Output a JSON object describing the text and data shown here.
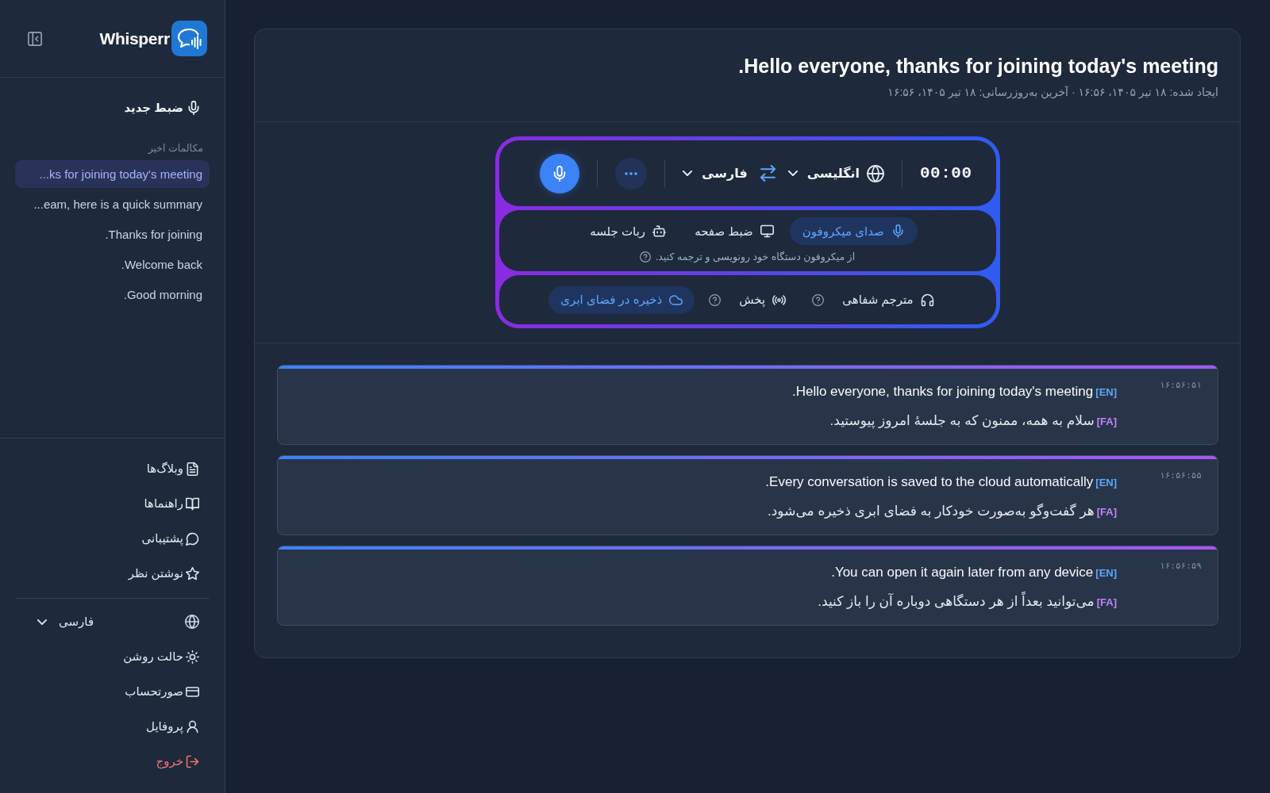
{
  "sidebar": {
    "brand": "Whisperr",
    "new_recording": "ضبط جدید",
    "recent_heading": "مکالمات اخیر",
    "conversations": [
      {
        "title": "...ks for joining today's meeting",
        "selected": true
      },
      {
        "title": "...eam, here is a quick summary",
        "selected": false
      },
      {
        "title": ".Thanks for joining",
        "selected": false
      },
      {
        "title": ".Welcome back",
        "selected": false
      },
      {
        "title": ".Good morning",
        "selected": false
      }
    ],
    "links": [
      {
        "label": "وبلاگ‌ها"
      },
      {
        "label": "راهنماها"
      },
      {
        "label": "پشتیبانی"
      },
      {
        "label": "نوشتن نظر"
      }
    ],
    "language": "فارسی",
    "account": [
      {
        "label": "حالت روشن",
        "kind": "link"
      },
      {
        "label": "صورتحساب",
        "kind": "link"
      },
      {
        "label": "پروفایل",
        "kind": "link"
      },
      {
        "label": "خروج",
        "kind": "danger"
      }
    ]
  },
  "meeting": {
    "title": ".Hello everyone, thanks for joining today's meeting",
    "meta": "ایجاد شده: ۱۸ تیر ۱۴۰۵، ۱۶:۵۶ · آخرین به‌روزرسانی: ۱۸ تیر ۱۴۰۵، ۱۶:۵۶"
  },
  "recorder": {
    "timer": "00:00",
    "source_language": "انگلیسی",
    "target_language": "فارسی",
    "sources": [
      {
        "label": "صدای میکروفون",
        "selected": true
      },
      {
        "label": "ضبط صفحه",
        "selected": false
      },
      {
        "label": "ربات جلسه",
        "selected": false
      }
    ],
    "hint": "از میکروفون دستگاه خود رونویسی و ترجمه کنید.",
    "options": [
      {
        "label": "مترجم شفاهی",
        "on": false,
        "help": true
      },
      {
        "label": "پخش",
        "on": false,
        "help": true
      },
      {
        "label": "ذخیره در فضای ابری",
        "on": true,
        "help": false
      }
    ]
  },
  "transcript": [
    {
      "time": "۱۶:۵۶:۵۱",
      "lines": [
        {
          "kind": "source",
          "tag": "[EN]",
          "text": ".Hello everyone, thanks for joining today's meeting"
        },
        {
          "kind": "translation",
          "tag": "[FA]",
          "text": "سلام به همه، ممنون که به جلسهٔ امروز پیوستید."
        }
      ]
    },
    {
      "time": "۱۶:۵۶:۵۵",
      "lines": [
        {
          "kind": "source",
          "tag": "[EN]",
          "text": ".Every conversation is saved to the cloud automatically"
        },
        {
          "kind": "translation",
          "tag": "[FA]",
          "text": "هر گفت‌وگو به‌صورت خودکار به فضای ابری ذخیره می‌شود."
        }
      ]
    },
    {
      "time": "۱۶:۵۶:۵۹",
      "lines": [
        {
          "kind": "source",
          "tag": "[EN]",
          "text": ".You can open it again later from any device"
        },
        {
          "kind": "translation",
          "tag": "[FA]",
          "text": "می‌توانید بعداً از هر دستگاهی دوباره آن را باز کنید."
        }
      ]
    }
  ]
}
